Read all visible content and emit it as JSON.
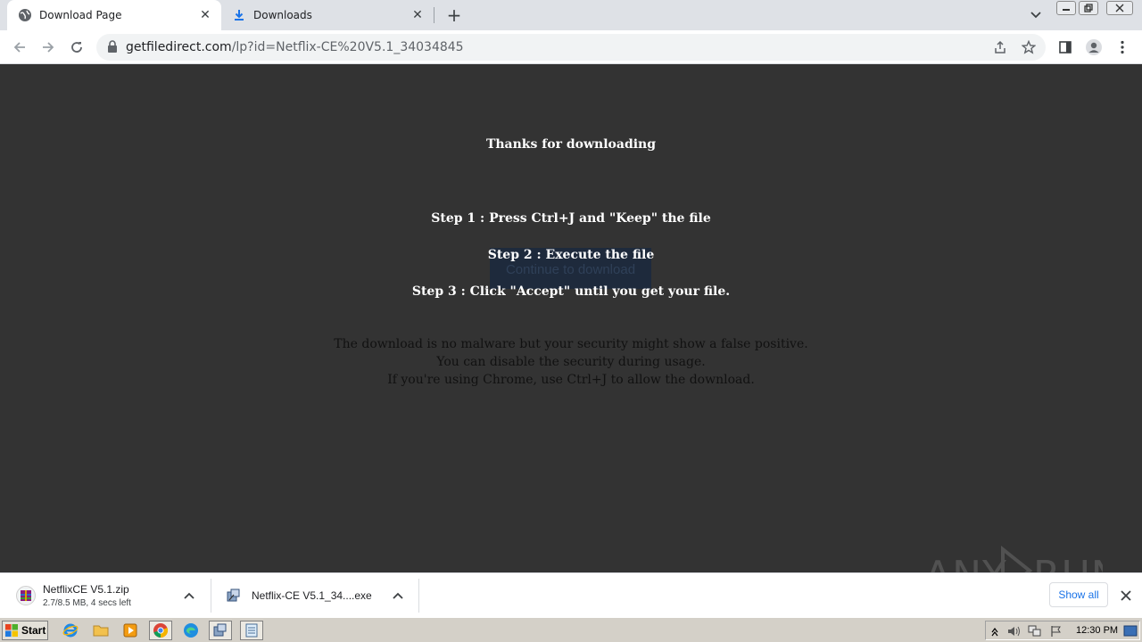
{
  "browser": {
    "tabs": [
      {
        "title": "Download Page",
        "icon": "globe-icon",
        "active": true
      },
      {
        "title": "Downloads",
        "icon": "download-icon",
        "active": false
      }
    ],
    "address": {
      "domain": "getfiledirect.com",
      "path": "/lp?id=Netflix-CE%20V5.1_34034845"
    }
  },
  "page": {
    "heading": "Thanks for downloading",
    "steps": [
      "Step 1 : Press Ctrl+J and \"Keep\" the file",
      "Step 2 : Execute the file",
      "Step 3 : Click \"Accept\" until you get your file."
    ],
    "continue_button": "Continue to download",
    "notes": [
      "The download is no malware but your security might show a false positive.",
      "You can disable the security during usage.",
      "If you're using Chrome, use Ctrl+J to allow the download."
    ],
    "background_color": "#333333"
  },
  "watermark": {
    "text": "ANY.RUN"
  },
  "downloads": [
    {
      "name": "NetflixCE V5.1.zip",
      "status": "2.7/8.5 MB, 4 secs left",
      "icon": "winrar-archive-icon"
    },
    {
      "name": "Netflix-CE V5.1_34....exe",
      "status": "",
      "icon": "installer-exe-icon"
    }
  ],
  "downloads_show_all": "Show all",
  "taskbar": {
    "start_label": "Start",
    "clock": "12:30 PM",
    "pinned": [
      "internet-explorer-icon",
      "folder-icon",
      "media-player-icon",
      "chrome-icon",
      "edge-icon",
      "installer-icon",
      "notepad-icon"
    ]
  }
}
